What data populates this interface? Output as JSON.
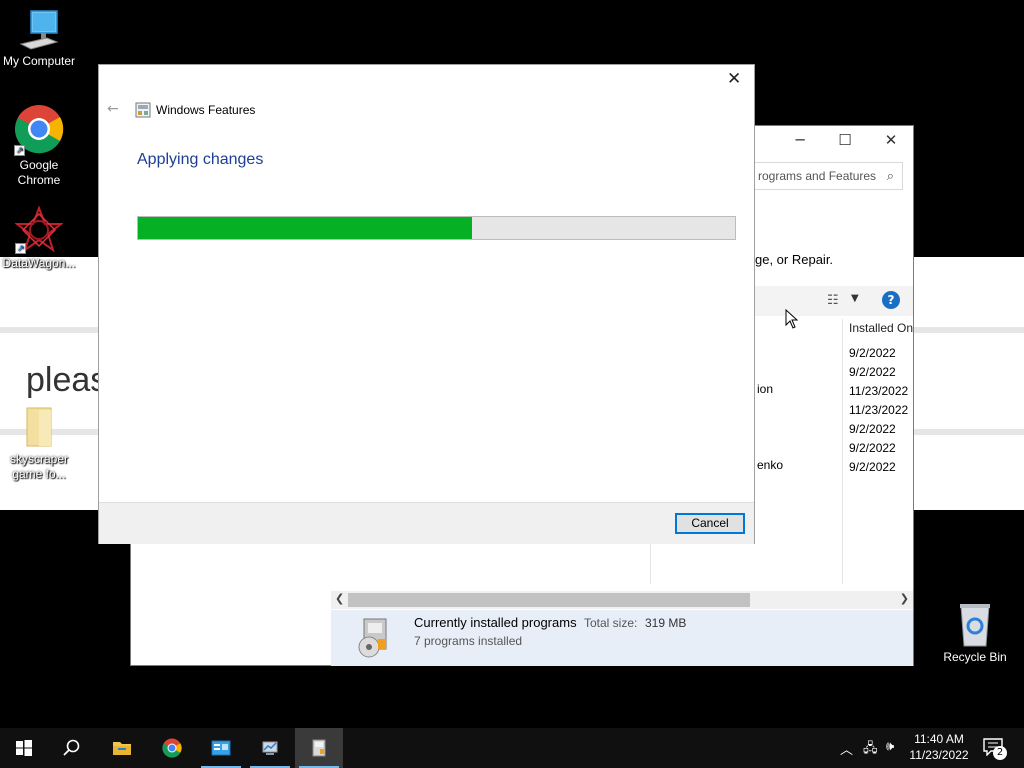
{
  "desktop": {
    "icons": [
      {
        "label": "My Computer"
      },
      {
        "label": "Google\nChrome"
      },
      {
        "label": "DataWagon..."
      },
      {
        "label": "skyscraper\ngame fo..."
      },
      {
        "label": "Recycle Bin"
      }
    ],
    "background_page_text": "pleas"
  },
  "programs_window": {
    "search_placeholder": "rograms and Features",
    "description_fragment": "ge, or Repair.",
    "column_header": "Installed On",
    "installed_dates": [
      "9/2/2022",
      "9/2/2022",
      "11/23/2022",
      "11/23/2022",
      "9/2/2022",
      "9/2/2022",
      "9/2/2022"
    ],
    "name_fragments": [
      "ion",
      "enko"
    ],
    "status": {
      "title": "Currently installed programs",
      "total_size_label": "Total size:",
      "total_size_value": "319 MB",
      "count_text": "7 programs installed"
    }
  },
  "windows_features": {
    "title": "Windows Features",
    "heading": "Applying changes",
    "progress": 0.56,
    "cancel_label": "Cancel"
  },
  "taskbar": {
    "time": "11:40 AM",
    "date": "11/23/2022",
    "notification_count": "2"
  },
  "colors": {
    "progress_fill": "#06b025",
    "heading": "#1c3f94",
    "accent": "#0078d7"
  }
}
